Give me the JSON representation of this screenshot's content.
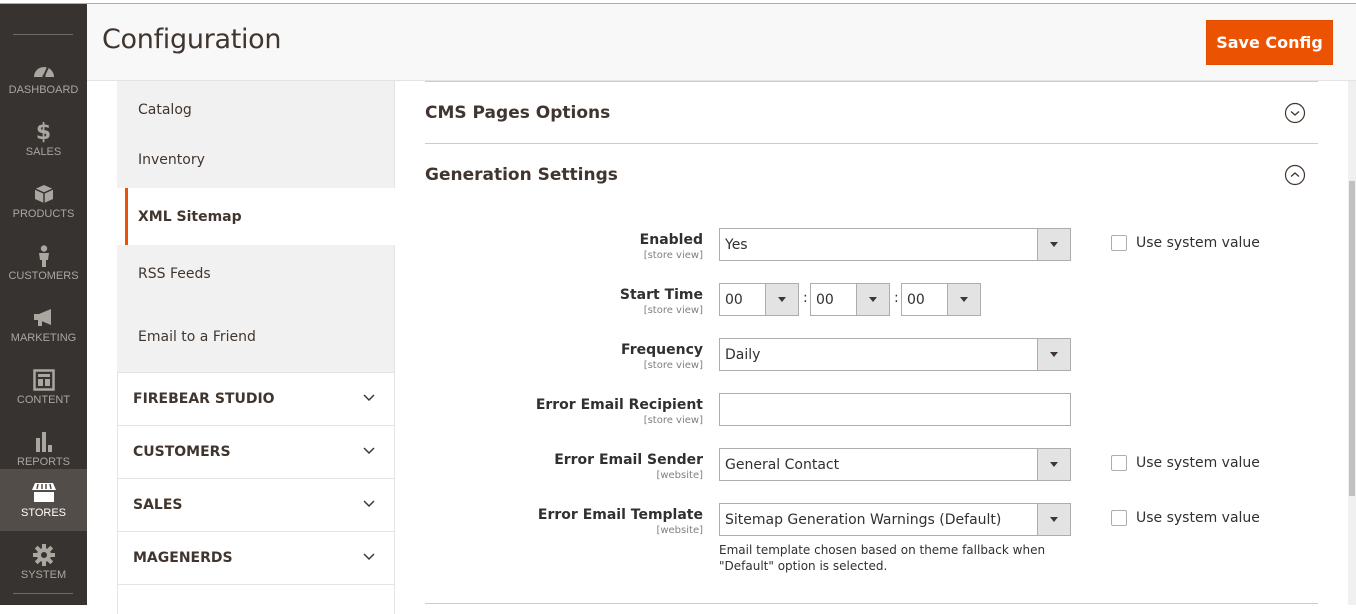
{
  "nav": {
    "items": [
      {
        "id": "dashboard",
        "label": "DASHBOARD",
        "icon": "dashboard-gauge-icon"
      },
      {
        "id": "sales",
        "label": "SALES",
        "icon": "dollar-icon"
      },
      {
        "id": "products",
        "label": "PRODUCTS",
        "icon": "box-icon"
      },
      {
        "id": "customers",
        "label": "CUSTOMERS",
        "icon": "person-icon"
      },
      {
        "id": "marketing",
        "label": "MARKETING",
        "icon": "megaphone-icon"
      },
      {
        "id": "content",
        "label": "CONTENT",
        "icon": "layout-icon"
      },
      {
        "id": "reports",
        "label": "REPORTS",
        "icon": "bar-chart-icon"
      },
      {
        "id": "stores",
        "label": "STORES",
        "icon": "storefront-icon",
        "active": true
      },
      {
        "id": "system",
        "label": "SYSTEM",
        "icon": "gear-icon"
      }
    ]
  },
  "header": {
    "title": "Configuration",
    "save_label": "Save Config",
    "accent": "#eb5202"
  },
  "config_tabs": {
    "sub_items": [
      {
        "label": "Catalog"
      },
      {
        "label": "Inventory"
      },
      {
        "label": "XML Sitemap",
        "active": true
      },
      {
        "label": "RSS Feeds"
      },
      {
        "label": "Email to a Friend"
      }
    ],
    "groups": [
      {
        "label": "FIREBEAR STUDIO"
      },
      {
        "label": "CUSTOMERS"
      },
      {
        "label": "SALES"
      },
      {
        "label": "MAGENERDS"
      }
    ]
  },
  "sections": {
    "cms_pages": {
      "title": "CMS Pages Options",
      "expanded": false
    },
    "generation": {
      "title": "Generation Settings",
      "expanded": true
    }
  },
  "fields": {
    "enabled": {
      "label": "Enabled",
      "scope": "[store view]",
      "value": "Yes",
      "use_system_label": "Use system value",
      "use_system_checked": false
    },
    "start_time": {
      "label": "Start Time",
      "scope": "[store view]",
      "hour": "00",
      "minute": "00",
      "second": "00",
      "separator": ":"
    },
    "frequency": {
      "label": "Frequency",
      "scope": "[store view]",
      "value": "Daily"
    },
    "error_recipient": {
      "label": "Error Email Recipient",
      "scope": "[store view]",
      "value": ""
    },
    "error_sender": {
      "label": "Error Email Sender",
      "scope": "[website]",
      "value": "General Contact",
      "use_system_label": "Use system value",
      "use_system_checked": false
    },
    "error_template": {
      "label": "Error Email Template",
      "scope": "[website]",
      "value": "Sitemap Generation Warnings (Default)",
      "use_system_label": "Use system value",
      "use_system_checked": false,
      "note": "Email template chosen based on theme fallback when \"Default\" option is selected."
    }
  }
}
